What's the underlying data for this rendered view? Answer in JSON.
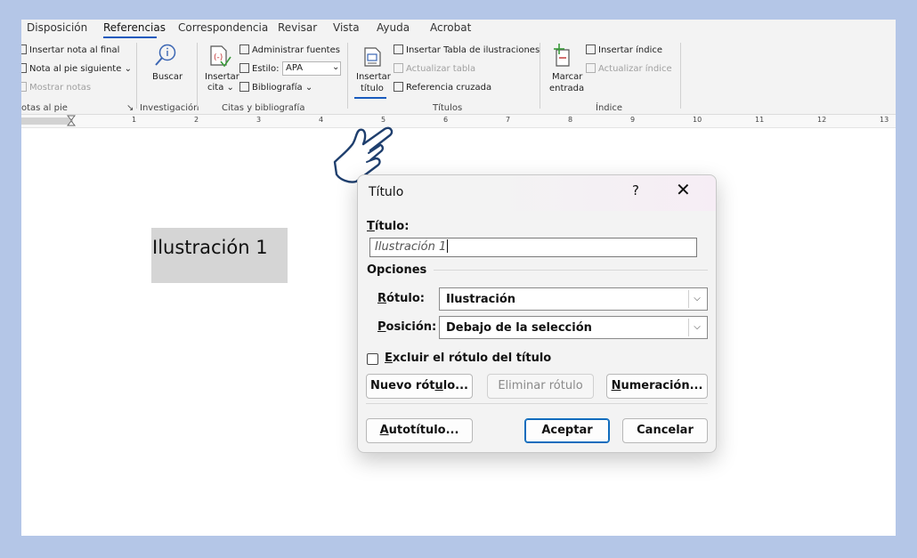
{
  "ribbon_tabs": [
    "Disposición",
    "Referencias",
    "Correspondencia",
    "Revisar",
    "Vista",
    "Ayuda",
    "Acrobat"
  ],
  "ribbon": {
    "footnotes": {
      "insert_endnote": "Insertar nota al final",
      "next_footnote": "Nota al pie siguiente",
      "next_footnote_caret": "⌄",
      "show_notes": "Mostrar notas",
      "group": "otas al pie"
    },
    "research": {
      "search": "Buscar",
      "group": "Investigación"
    },
    "citations": {
      "insert_citation_1": "Insertar",
      "insert_citation_2": "cita ⌄",
      "manage_sources": "Administrar fuentes",
      "style_label": "Estilo:",
      "style_value": "APA",
      "bibliography": "Bibliografía ⌄",
      "group": "Citas y bibliografía"
    },
    "captions": {
      "insert_caption_1": "Insertar",
      "insert_caption_2": "título",
      "insert_table_of_figures": "Insertar Tabla de ilustraciones",
      "update_table": "Actualizar tabla",
      "cross_reference": "Referencia cruzada",
      "group": "Títulos"
    },
    "index": {
      "mark_entry_1": "Marcar",
      "mark_entry_2": "entrada",
      "insert_index": "Insertar índice",
      "update_index": "Actualizar índice",
      "group": "Índice"
    }
  },
  "ruler_numbers": [
    "1",
    "2",
    "3",
    "4",
    "5",
    "6",
    "7",
    "8",
    "9",
    "10",
    "11",
    "12",
    "13"
  ],
  "document": {
    "selected_text": "Ilustración 1"
  },
  "dialog": {
    "title": "Título",
    "help": "?",
    "close": "✕",
    "caption_label": "Título:",
    "caption_value": "Ilustración 1",
    "options_label": "Opciones",
    "label_label": "Rótulo:",
    "label_value": "Ilustración",
    "position_label": "Posición:",
    "position_value": "Debajo de la selección",
    "exclude_label": "Excluir el rótulo del título",
    "exclude_checked": false,
    "new_label_button": "Nuevo rótulo...",
    "delete_label_button": "Eliminar rótulo",
    "numbering_button": "Numeración...",
    "autocaption_button": "Autotítulo...",
    "ok_button": "Aceptar",
    "cancel_button": "Cancelar"
  }
}
